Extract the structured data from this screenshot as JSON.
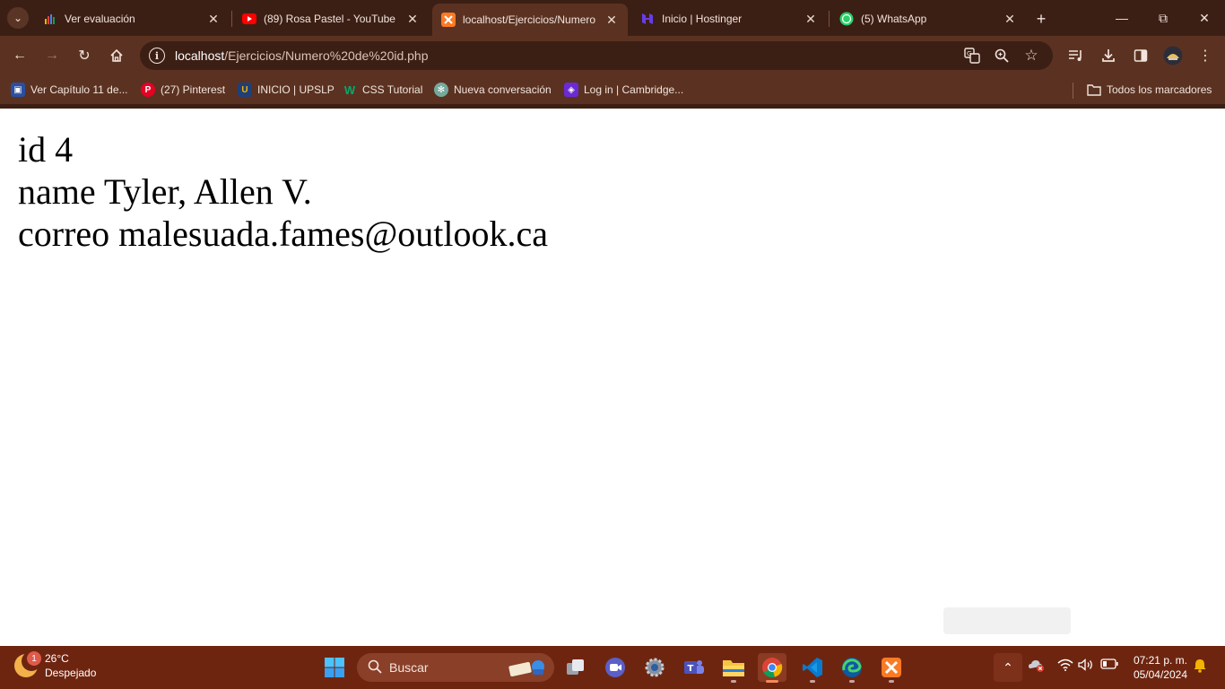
{
  "browser": {
    "tabs": [
      {
        "title": "Ver evaluación",
        "icon": "bar-chart-icon"
      },
      {
        "title": "(89) Rosa Pastel - YouTube",
        "icon": "youtube-icon"
      },
      {
        "title": "localhost/Ejercicios/Numero",
        "icon": "xampp-icon",
        "active": true
      },
      {
        "title": "Inicio | Hostinger",
        "icon": "hostinger-icon"
      },
      {
        "title": "(5) WhatsApp",
        "icon": "whatsapp-icon"
      }
    ],
    "address": {
      "host": "localhost",
      "path": "/Ejercicios/Numero%20de%20id.php"
    },
    "bookmarks": [
      {
        "label": "Ver Capítulo 11 de..."
      },
      {
        "label": "(27) Pinterest"
      },
      {
        "label": "INICIO | UPSLP"
      },
      {
        "label": "CSS Tutorial"
      },
      {
        "label": "Nueva conversación"
      },
      {
        "label": "Log in | Cambridge..."
      }
    ],
    "all_bookmarks_label": "Todos los marcadores"
  },
  "page": {
    "line1": "id 4",
    "line2": "name Tyler, Allen V.",
    "line3": "correo malesuada.fames@outlook.ca"
  },
  "taskbar": {
    "weather_temp": "26°C",
    "weather_desc": "Despejado",
    "weather_badge": "1",
    "search_label": "Buscar",
    "time": "07:21 p. m.",
    "date": "05/04/2024"
  },
  "colors": {
    "frame": "#3c1f14",
    "toolbar": "#5b3221",
    "taskbar": "#6e2510"
  }
}
